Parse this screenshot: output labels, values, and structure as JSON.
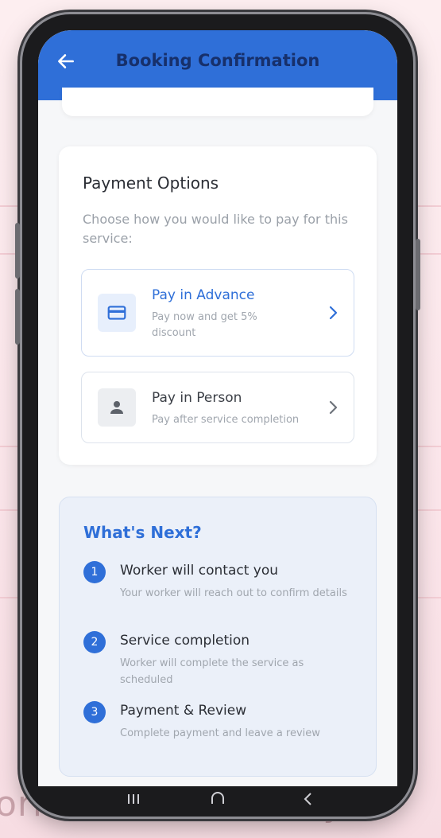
{
  "background": {
    "bottom_text": "orker will contact you"
  },
  "appbar": {
    "title": "Booking Confirmation",
    "back_icon": "arrow-left-icon",
    "color": "#2f6fd8"
  },
  "payment": {
    "title": "Payment Options",
    "description": "Choose how you would like to pay for this service:",
    "options": [
      {
        "label": "Pay in Advance",
        "subtitle": "Pay now and get 5% discount",
        "icon": "credit-card-icon"
      },
      {
        "label": "Pay in Person",
        "subtitle": "Pay after service completion",
        "icon": "person-icon"
      }
    ]
  },
  "next": {
    "title": "What's Next?",
    "steps": [
      {
        "number": "1",
        "title": "Worker will contact you",
        "description": "Your worker will reach out to confirm details"
      },
      {
        "number": "2",
        "title": "Service completion",
        "description": "Worker will complete the service as scheduled"
      },
      {
        "number": "3",
        "title": "Payment & Review",
        "description": "Complete payment and leave a review"
      }
    ]
  },
  "colors": {
    "accent": "#2f6fd8",
    "text_dark": "#2b2e35",
    "text_muted": "#a0a6ae"
  }
}
